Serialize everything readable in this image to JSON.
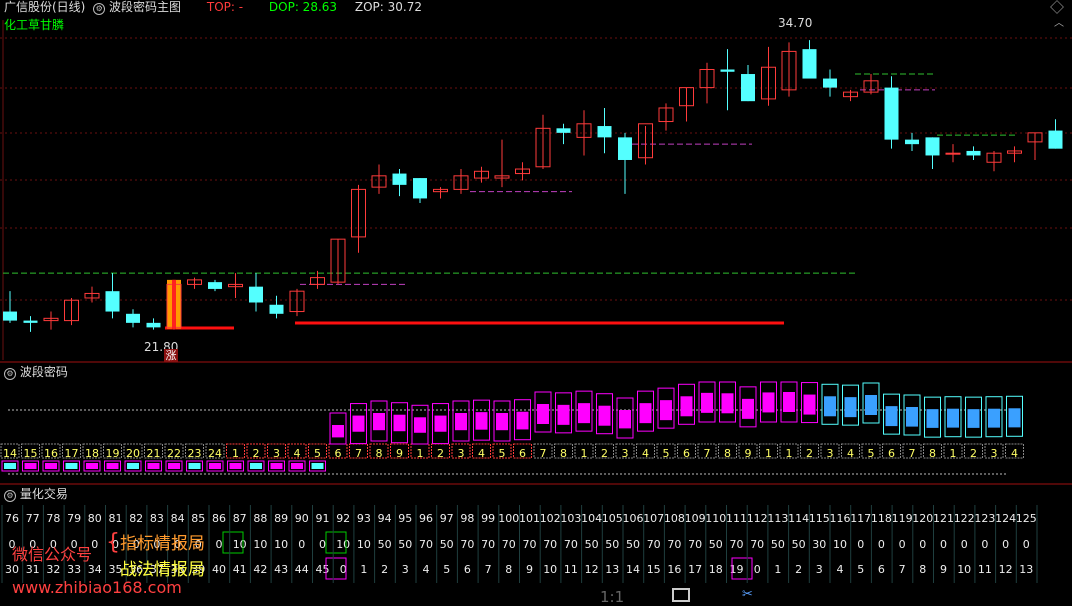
{
  "header": {
    "stock_name": "广信股份(日线)",
    "indicator_name": "波段密码主图",
    "top_label": "TOP: -",
    "dop_label": "DOP: 28.63",
    "zop_label": "ZOP: 30.72",
    "theme_tag": "化工草甘膦"
  },
  "price_labels": {
    "high": "34.70",
    "low": "21.80",
    "zhang": "涨"
  },
  "panels": {
    "wave_title": "波段密码",
    "quant_title": "量化交易"
  },
  "footer": {
    "zoom": "1:1"
  },
  "watermark": {
    "wechat": "微信公众号",
    "line1": "指标情报局",
    "line2": "战法情报局",
    "url": "www.zhibiao168.com"
  },
  "colors": {
    "up": "#ff3b3b",
    "down": "#54ffff",
    "magenta": "#ff00ff",
    "yellow": "#ffff00",
    "green": "#00ff00"
  },
  "chart_data": {
    "type": "candlestick",
    "candles": [
      [
        22.7,
        23.6,
        22.2,
        22.3
      ],
      [
        22.3,
        22.5,
        21.8,
        22.2
      ],
      [
        22.3,
        22.7,
        21.9,
        22.4
      ],
      [
        22.3,
        23.3,
        22.1,
        23.2
      ],
      [
        23.3,
        23.8,
        23.1,
        23.5
      ],
      [
        23.6,
        24.4,
        22.4,
        22.7
      ],
      [
        22.6,
        22.8,
        22.0,
        22.2
      ],
      [
        22.2,
        22.4,
        21.9,
        22.0
      ],
      [
        22.0,
        24.1,
        21.9,
        23.9
      ],
      [
        23.9,
        24.2,
        23.7,
        24.1
      ],
      [
        24.0,
        24.1,
        23.6,
        23.7
      ],
      [
        23.8,
        24.4,
        23.3,
        23.9
      ],
      [
        23.8,
        24.4,
        22.7,
        23.1
      ],
      [
        23.0,
        23.4,
        22.4,
        22.6
      ],
      [
        22.7,
        23.7,
        22.5,
        23.6
      ],
      [
        23.9,
        24.5,
        23.7,
        24.2
      ],
      [
        24.0,
        25.9,
        23.9,
        25.9
      ],
      [
        26.0,
        28.3,
        25.3,
        28.1
      ],
      [
        28.2,
        29.2,
        27.9,
        28.7
      ],
      [
        28.8,
        29.0,
        27.8,
        28.3
      ],
      [
        28.6,
        28.6,
        27.5,
        27.7
      ],
      [
        28.0,
        28.2,
        27.7,
        28.1
      ],
      [
        28.1,
        29.0,
        27.9,
        28.7
      ],
      [
        28.6,
        29.1,
        28.4,
        28.9
      ],
      [
        28.6,
        30.3,
        28.2,
        28.7
      ],
      [
        28.8,
        29.3,
        28.5,
        29.0
      ],
      [
        29.1,
        31.4,
        29.0,
        30.8
      ],
      [
        30.8,
        31.0,
        30.1,
        30.6
      ],
      [
        30.4,
        31.6,
        29.6,
        31.0
      ],
      [
        30.9,
        31.7,
        29.7,
        30.4
      ],
      [
        30.4,
        30.6,
        27.9,
        29.4
      ],
      [
        29.5,
        30.9,
        29.2,
        31.0
      ],
      [
        31.1,
        31.9,
        30.7,
        31.7
      ],
      [
        31.8,
        32.6,
        31.1,
        32.6
      ],
      [
        32.6,
        33.7,
        31.9,
        33.4
      ],
      [
        33.4,
        34.3,
        31.6,
        33.3
      ],
      [
        33.2,
        33.6,
        32.0,
        32.0
      ],
      [
        32.1,
        34.4,
        31.8,
        33.5
      ],
      [
        32.5,
        34.6,
        32.2,
        34.2
      ],
      [
        34.3,
        34.7,
        33.2,
        33.0
      ],
      [
        33.0,
        33.4,
        32.2,
        32.6
      ],
      [
        32.2,
        32.5,
        32.0,
        32.4
      ],
      [
        32.4,
        33.2,
        32.3,
        32.9
      ],
      [
        32.6,
        33.1,
        29.9,
        30.3
      ],
      [
        30.3,
        30.6,
        29.8,
        30.1
      ],
      [
        30.4,
        30.4,
        29.0,
        29.6
      ],
      [
        29.7,
        30.1,
        29.3,
        29.7
      ],
      [
        29.8,
        30.0,
        29.4,
        29.6
      ],
      [
        29.3,
        29.8,
        28.9,
        29.7
      ],
      [
        29.7,
        30.0,
        29.3,
        29.8
      ],
      [
        30.2,
        30.6,
        29.4,
        30.6
      ],
      [
        30.7,
        31.2,
        29.9,
        29.9
      ]
    ],
    "ylim": [
      21.0,
      35.5
    ]
  },
  "wave_counts": [
    "14",
    "15",
    "16",
    "17",
    "18",
    "19",
    "20",
    "21",
    "22",
    "23",
    "24",
    "1",
    "2",
    "3",
    "4",
    "5",
    "6",
    "7",
    "8",
    "9",
    "1",
    "2",
    "3",
    "4",
    "5",
    "6",
    "7",
    "8",
    "1",
    "2",
    "3",
    "4",
    "5",
    "6",
    "7",
    "8",
    "9",
    "1",
    "1",
    "2",
    "3",
    "4",
    "5",
    "6",
    "7",
    "8",
    "1",
    "2",
    "3",
    "4"
  ],
  "quant_rows": {
    "row1": [
      "76",
      "77",
      "78",
      "79",
      "80",
      "81",
      "82",
      "83",
      "84",
      "85",
      "86",
      "87",
      "88",
      "89",
      "90",
      "91",
      "92",
      "93",
      "94",
      "95",
      "96",
      "97",
      "98",
      "99",
      "100",
      "101",
      "102",
      "103",
      "104",
      "105",
      "106",
      "107",
      "108",
      "109",
      "110",
      "111",
      "112",
      "113",
      "114",
      "115",
      "116",
      "117",
      "118",
      "119",
      "120",
      "121",
      "122",
      "123",
      "124",
      "125"
    ],
    "row2": [
      "0",
      "0",
      "0",
      "0",
      "0",
      "0",
      "0",
      "0",
      "0",
      "0",
      "0",
      "10",
      "10",
      "10",
      "0",
      "0",
      "10",
      "10",
      "50",
      "50",
      "70",
      "50",
      "70",
      "70",
      "70",
      "70",
      "70",
      "70",
      "50",
      "50",
      "50",
      "70",
      "70",
      "70",
      "50",
      "70",
      "70",
      "50",
      "50",
      "30",
      "10",
      "0",
      "0",
      "0",
      "0",
      "0",
      "0",
      "0",
      "0",
      "0"
    ],
    "row3": [
      "30",
      "31",
      "32",
      "33",
      "34",
      "35",
      "36",
      "37",
      "38",
      "39",
      "40",
      "41",
      "42",
      "43",
      "44",
      "45",
      "0",
      "1",
      "2",
      "3",
      "4",
      "5",
      "6",
      "7",
      "8",
      "9",
      "10",
      "11",
      "12",
      "13",
      "14",
      "15",
      "16",
      "17",
      "18",
      "19",
      "0",
      "1",
      "2",
      "3",
      "4",
      "5",
      "6",
      "7",
      "8",
      "9",
      "10",
      "11",
      "12",
      "13"
    ]
  }
}
